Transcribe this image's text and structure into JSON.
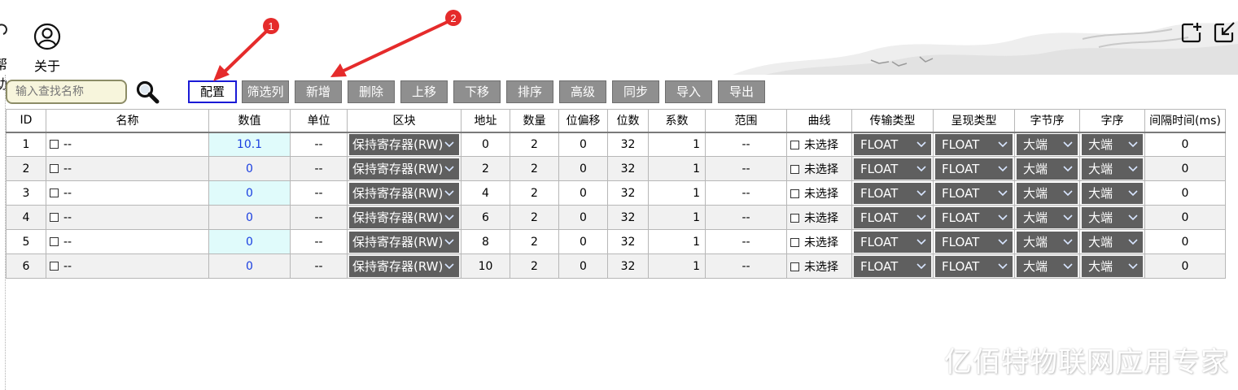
{
  "nav": {
    "help_label": "帮助",
    "about_label": "关于"
  },
  "search": {
    "placeholder": "输入查找名称"
  },
  "toolbar": {
    "buttons": [
      "配置",
      "筛选列",
      "新增",
      "删除",
      "上移",
      "下移",
      "排序",
      "高级",
      "同步",
      "导入",
      "导出"
    ],
    "active": "配置"
  },
  "annotations": {
    "badge_1": "1",
    "badge_2": "2",
    "badge_color": "#e52b2b",
    "arrow_color": "#e52b2b"
  },
  "table": {
    "columns": [
      "ID",
      "名称",
      "数值",
      "单位",
      "区块",
      "地址",
      "数量",
      "位偏移",
      "位数",
      "系数",
      "范围",
      "曲线",
      "传输类型",
      "呈现类型",
      "字节序",
      "字序",
      "间隔时间(ms)"
    ],
    "rows": [
      {
        "id": "1",
        "name": "--",
        "value": "10.1",
        "unit": "--",
        "block": "保持寄存器(RW)",
        "address": "0",
        "count": "2",
        "bit_offset": "0",
        "bits": "32",
        "factor": "1",
        "range": "--",
        "curve": "未选择",
        "transfer_type": "FLOAT",
        "display_type": "FLOAT",
        "byte_order": "大端",
        "word_order": "大端",
        "interval": "0"
      },
      {
        "id": "2",
        "name": "--",
        "value": "0",
        "unit": "--",
        "block": "保持寄存器(RW)",
        "address": "2",
        "count": "2",
        "bit_offset": "0",
        "bits": "32",
        "factor": "1",
        "range": "--",
        "curve": "未选择",
        "transfer_type": "FLOAT",
        "display_type": "FLOAT",
        "byte_order": "大端",
        "word_order": "大端",
        "interval": "0"
      },
      {
        "id": "3",
        "name": "--",
        "value": "0",
        "unit": "--",
        "block": "保持寄存器(RW)",
        "address": "4",
        "count": "2",
        "bit_offset": "0",
        "bits": "32",
        "factor": "1",
        "range": "--",
        "curve": "未选择",
        "transfer_type": "FLOAT",
        "display_type": "FLOAT",
        "byte_order": "大端",
        "word_order": "大端",
        "interval": "0"
      },
      {
        "id": "4",
        "name": "--",
        "value": "0",
        "unit": "--",
        "block": "保持寄存器(RW)",
        "address": "6",
        "count": "2",
        "bit_offset": "0",
        "bits": "32",
        "factor": "1",
        "range": "--",
        "curve": "未选择",
        "transfer_type": "FLOAT",
        "display_type": "FLOAT",
        "byte_order": "大端",
        "word_order": "大端",
        "interval": "0"
      },
      {
        "id": "5",
        "name": "--",
        "value": "0",
        "unit": "--",
        "block": "保持寄存器(RW)",
        "address": "8",
        "count": "2",
        "bit_offset": "0",
        "bits": "32",
        "factor": "1",
        "range": "--",
        "curve": "未选择",
        "transfer_type": "FLOAT",
        "display_type": "FLOAT",
        "byte_order": "大端",
        "word_order": "大端",
        "interval": "0"
      },
      {
        "id": "6",
        "name": "--",
        "value": "0",
        "unit": "--",
        "block": "保持寄存器(RW)",
        "address": "10",
        "count": "2",
        "bit_offset": "0",
        "bits": "32",
        "factor": "1",
        "range": "--",
        "curve": "未选择",
        "transfer_type": "FLOAT",
        "display_type": "FLOAT",
        "byte_order": "大端",
        "word_order": "大端",
        "interval": "0"
      }
    ]
  },
  "watermark": "亿佰特物联网应用专家"
}
